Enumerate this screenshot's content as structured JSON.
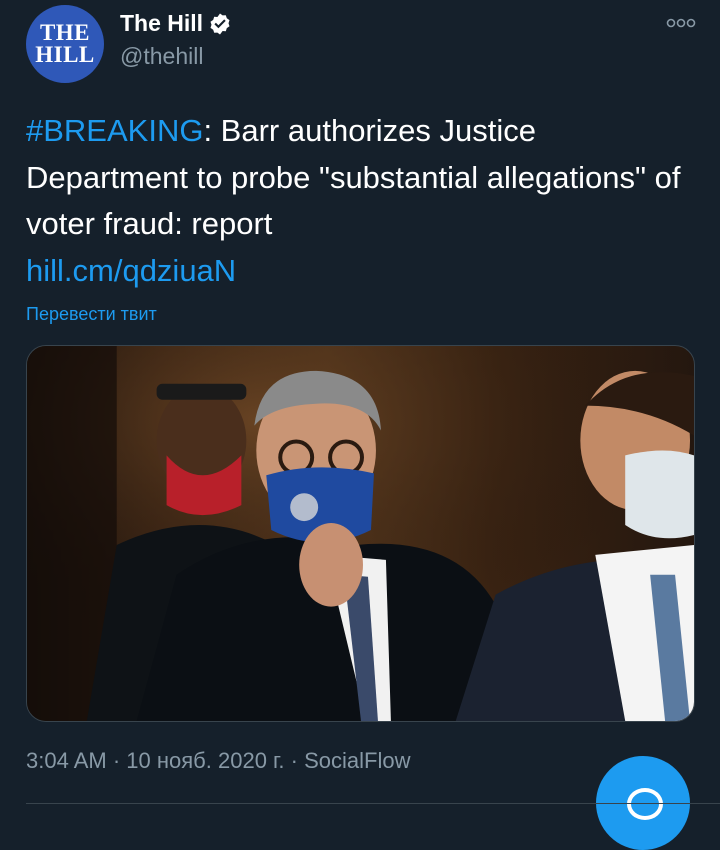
{
  "account": {
    "avatar_line1": "THE",
    "avatar_line2": "HILL",
    "name": "The Hill",
    "handle": "@thehill"
  },
  "tweet": {
    "hashtag": "#BREAKING",
    "text": ": Barr authorizes Justice Department to probe \"substantial allegations\" of voter fraud: report",
    "link": "hill.cm/qdziuaN",
    "translate_label": "Перевести твит"
  },
  "meta": {
    "time": "3:04 AM",
    "separator": "·",
    "date": "10 нояб. 2020 г.",
    "source": "SocialFlow"
  },
  "colors": {
    "background": "#15202b",
    "accent": "#1d9bf0",
    "muted": "#8899a6",
    "avatar": "#2f58b8"
  },
  "icons": {
    "verified": "verified-badge-icon",
    "more": "more-dots-icon",
    "compose": "compose-fab-icon"
  }
}
